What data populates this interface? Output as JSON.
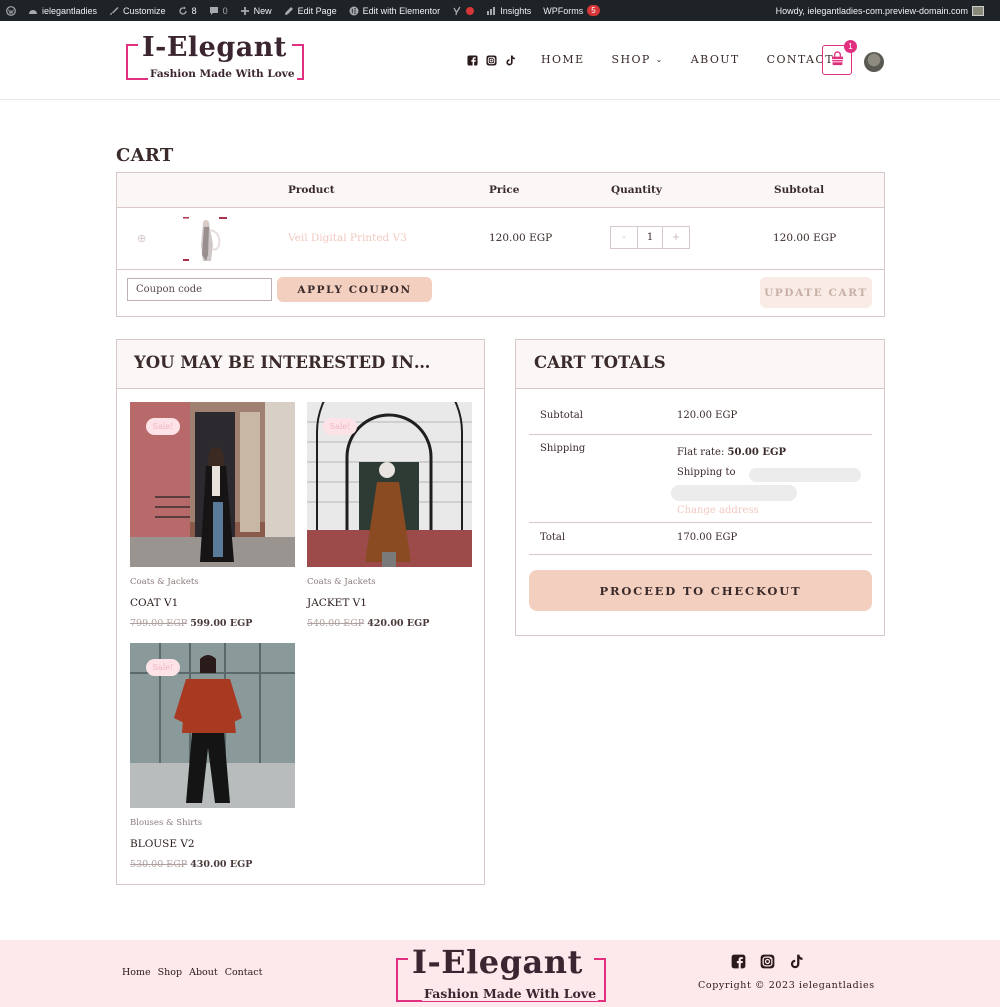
{
  "admin_bar": {
    "site_name": "ielegantladies",
    "customize": "Customize",
    "updates_count": "8",
    "comments_count": "0",
    "new": "New",
    "edit_page": "Edit Page",
    "edit_elementor": "Edit with Elementor",
    "insights": "Insights",
    "wpforms": "WPForms",
    "wpforms_badge": "5",
    "howdy": "Howdy, ielegantladies-com.preview-domain.com"
  },
  "header": {
    "logo_title": "I-Elegant",
    "logo_tagline": "Fashion Made With Love",
    "social_icons": [
      "facebook-icon",
      "instagram-icon",
      "tiktok-icon"
    ],
    "nav": [
      "HOME",
      "SHOP",
      "ABOUT",
      "CONTACT"
    ],
    "cart_count": "1",
    "accent_color": "#e0307f"
  },
  "cart": {
    "title": "CART",
    "columns": {
      "product": "Product",
      "price": "Price",
      "quantity": "Quantity",
      "subtotal": "Subtotal"
    },
    "items": [
      {
        "name": "Veil Digital Printed V3",
        "price": "120.00 EGP",
        "quantity": "1",
        "subtotal": "120.00 EGP"
      }
    ],
    "coupon_placeholder": "Coupon code",
    "apply_coupon": "APPLY COUPON",
    "update_cart": "UPDATE CART"
  },
  "upsell": {
    "title": "YOU MAY BE INTERESTED IN…",
    "products": [
      {
        "sale": "Sale!",
        "category": "Coats & Jackets",
        "name": "COAT V1",
        "old_price": "799.00 EGP",
        "price": "599.00 EGP"
      },
      {
        "sale": "Sale!",
        "category": "Coats & Jackets",
        "name": "JACKET V1",
        "old_price": "540.00 EGP",
        "price": "420.00 EGP"
      },
      {
        "sale": "Sale!",
        "category": "Blouses & Shirts",
        "name": "BLOUSE V2",
        "old_price": "530.00 EGP",
        "price": "430.00 EGP"
      }
    ]
  },
  "totals": {
    "title": "CART TOTALS",
    "subtotal_label": "Subtotal",
    "subtotal": "120.00 EGP",
    "shipping_label": "Shipping",
    "flat_rate_label": "Flat rate:",
    "flat_rate": "50.00 EGP",
    "shipping_to": "Shipping to",
    "change_address": "Change address",
    "total_label": "Total",
    "total": "170.00 EGP",
    "checkout": "PROCEED TO CHECKOUT",
    "button_color": "#f3cfbf"
  },
  "footer": {
    "nav": [
      "Home",
      "Shop",
      "About",
      "Contact"
    ],
    "logo_title": "I-Elegant",
    "logo_tagline": "Fashion Made With Love",
    "copyright": "Copyright © 2023 ielegantladies",
    "background": "#fde9ec"
  }
}
